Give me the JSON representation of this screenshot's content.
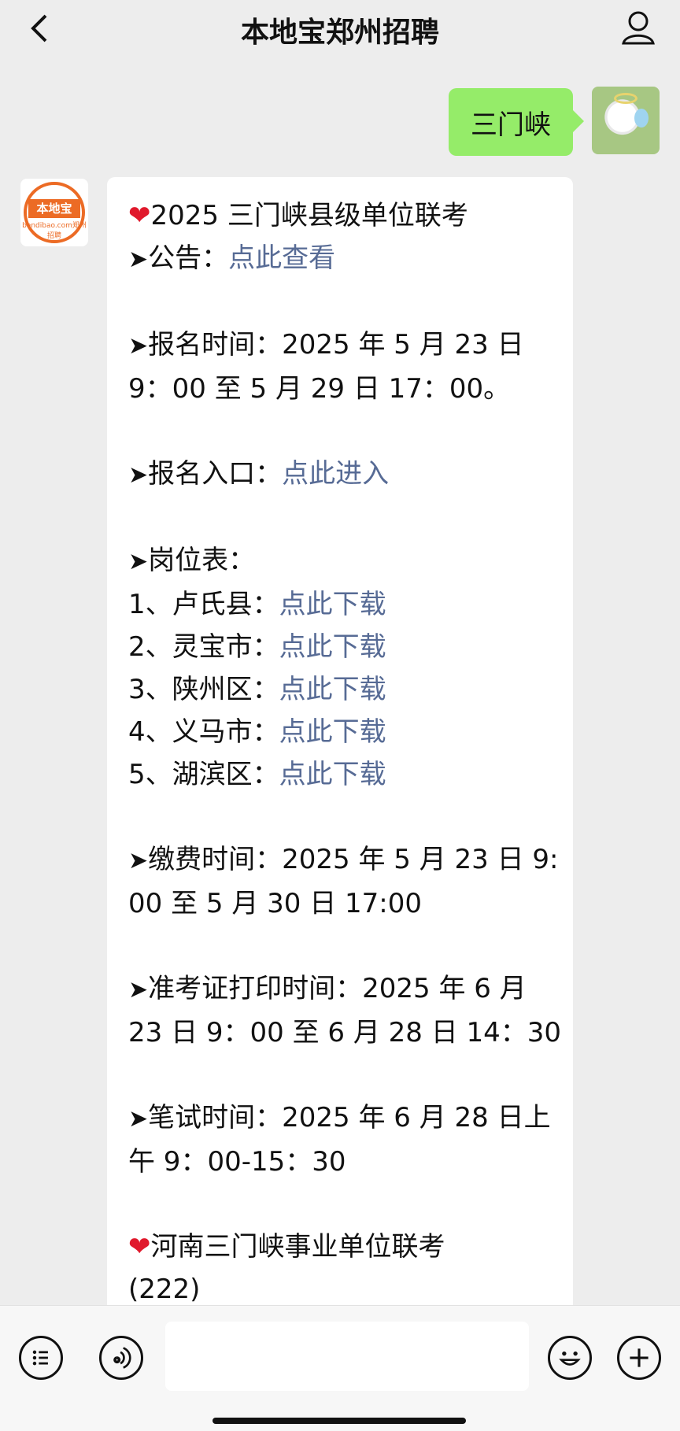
{
  "header": {
    "title": "本地宝郑州招聘",
    "back_icon": "back-icon",
    "profile_icon": "profile-icon"
  },
  "my_message": {
    "text": "三门峡",
    "avatar": "dog-avatar"
  },
  "bot": {
    "avatar_logo": "本地宝",
    "avatar_subtitle": "bendibao.com郑州招聘"
  },
  "message": {
    "title": "2025 三门峡县级单位联考",
    "notice_label": "公告：",
    "notice_link": "点此查看",
    "signup_time_line1": "报名时间：2025 年 5 月 23 日",
    "signup_time_line2": "9：00 至 5 月 29 日 17：00。",
    "signup_entry_label": "报名入口：",
    "signup_entry_link": "点此进入",
    "jobs_label": "岗位表：",
    "jobs": [
      {
        "label": "1、卢氏县：",
        "link": "点此下载"
      },
      {
        "label": "2、灵宝市：",
        "link": "点此下载"
      },
      {
        "label": "3、陕州区：",
        "link": "点此下载"
      },
      {
        "label": "4、义马市：",
        "link": "点此下载"
      },
      {
        "label": "5、湖滨区：",
        "link": "点此下载"
      }
    ],
    "payment_line1": "缴费时间：2025 年 5 月 23 日 9:",
    "payment_line2": "00 至 5 月 30 日 17:00",
    "admission_line1": "准考证打印时间：2025 年 6 月",
    "admission_line2": "23 日 9：00 至 6 月 28 日 14：30",
    "exam_line1": "笔试时间：2025 年 6 月 28 日上",
    "exam_line2": "午 9：00-15：30",
    "next_title": "河南三门峡事业单位联考",
    "next_count": "(222)"
  },
  "icons": {
    "heart": "❤",
    "arrow": "➤"
  },
  "input_bar": {
    "left_icons": [
      "list-icon",
      "voice-icon"
    ],
    "right_icons": [
      "emoji-icon",
      "plus-icon"
    ]
  },
  "colors": {
    "bubble_green": "#95ec69",
    "link": "#576b95",
    "heart": "#e0192c",
    "brand_orange": "#ec6b25"
  }
}
